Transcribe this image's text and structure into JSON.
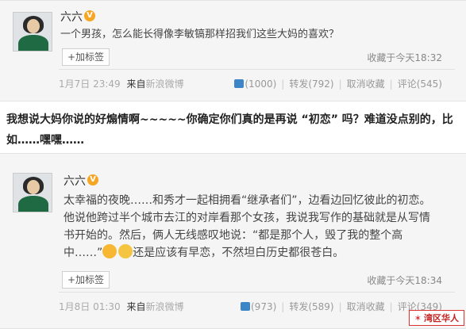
{
  "post1": {
    "username": "六六",
    "verified_badge": "V",
    "content": "一个男孩，怎么能长得像李敏镐那样招我们这些大妈的喜欢？",
    "tag_button": "+加标签",
    "collection_time": "收藏于今天18:32",
    "date": "1月7日 23:49",
    "source_prefix": "来自",
    "source_name": "新浪微博",
    "likes": "(1000)",
    "repost": "转发(792)",
    "favorite": "取消收藏",
    "comment": "评论(545)"
  },
  "comment_text": "我想说大妈你说的好煽情啊~~~~~你确定你们真的是再说 “初恋” 吗？难道没点别的，比如……嘿嘿……",
  "post2": {
    "username": "六六",
    "verified_badge": "V",
    "content_main": "太幸福的夜晚……和秀才一起相拥看“继承者们”，边看边回忆彼此的初恋。他说他跨过半个城市去江的对岸看那个女孩，我说我写作的基础就是从写情书开始的。然后，俩人无线感叹地说：“都是那个人，毁了我的整个高中……”",
    "content_tail": "还是应该有早恋，不然坦白历史都很苍白。",
    "tag_button": "+加标签",
    "collection_time": "收藏于今天18:34",
    "date": "1月8日 01:30",
    "source_prefix": "来自",
    "source_name": "新浪微博",
    "likes": "(973)",
    "repost": "转发(589)",
    "favorite": "取消收藏",
    "comment": "评论(349)"
  },
  "watermark": "湾区华人",
  "colors": {
    "link": "#3c86c8",
    "badge": "#f5a623",
    "watermark": "#c21f1f"
  }
}
